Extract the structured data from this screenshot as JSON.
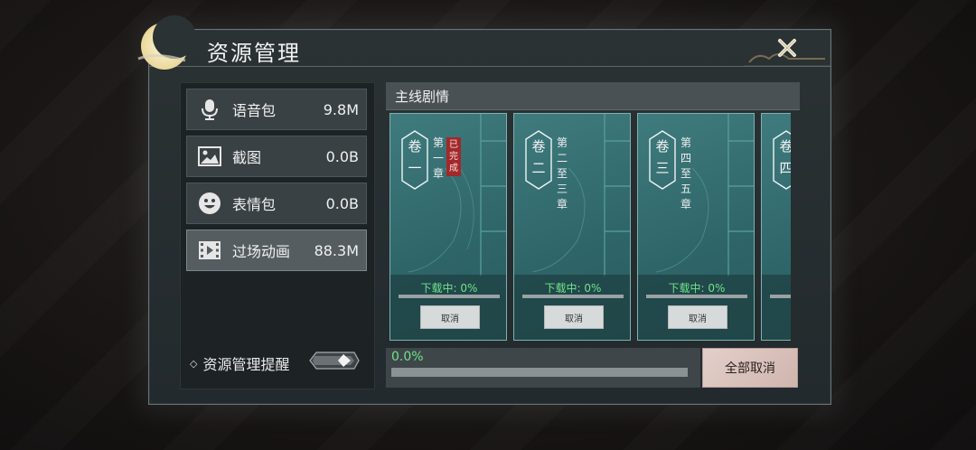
{
  "window": {
    "title": "资源管理"
  },
  "resources": [
    {
      "label": "语音包",
      "size": "9.8M",
      "icon": "microphone-icon"
    },
    {
      "label": "截图",
      "size": "0.0B",
      "icon": "image-icon"
    },
    {
      "label": "表情包",
      "size": "0.0B",
      "icon": "smiley-icon"
    },
    {
      "label": "过场动画",
      "size": "88.3M",
      "icon": "film-icon",
      "selected": true
    }
  ],
  "reminder": {
    "label": "资源管理提醒",
    "enabled": false
  },
  "section": {
    "title": "主线剧情"
  },
  "volumes": [
    {
      "vol": "卷一",
      "chapters": "第一章",
      "badge": "已完成",
      "status": "下载中: 0%",
      "progress": 0,
      "cancel": "取消"
    },
    {
      "vol": "卷二",
      "chapters": "第二至三章",
      "status": "下载中: 0%",
      "progress": 0,
      "cancel": "取消"
    },
    {
      "vol": "卷三",
      "chapters": "第四至五章",
      "status": "下载中: 0%",
      "progress": 0,
      "cancel": "取消"
    },
    {
      "vol": "卷四",
      "chapters": "",
      "status": "",
      "progress": 0,
      "cancel": ""
    }
  ],
  "overall": {
    "percent_text": "0.0%",
    "progress": 0,
    "cancel_all": "全部取消"
  },
  "colors": {
    "accent_green": "#6fe38a",
    "card_teal": "#3f7b7e",
    "seal_red": "#a3282a"
  }
}
